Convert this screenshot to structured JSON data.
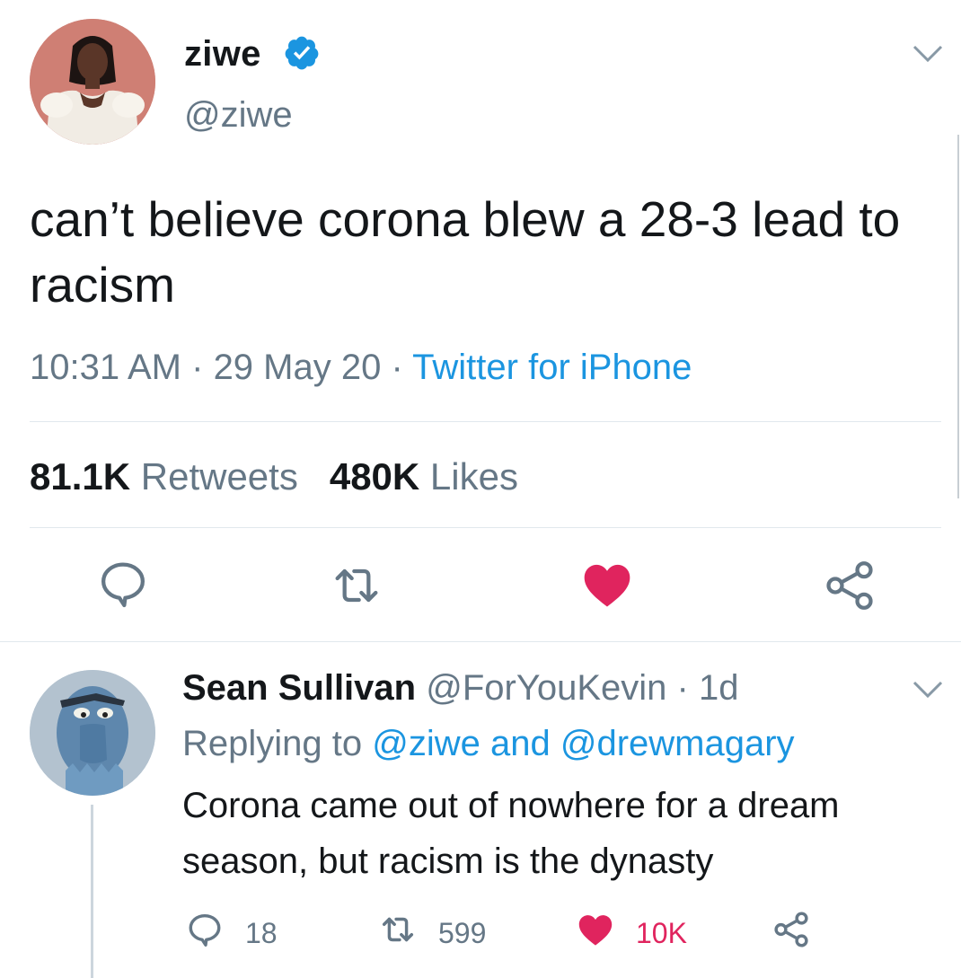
{
  "tweet": {
    "display_name": "ziwe",
    "handle": "@ziwe",
    "text": "can’t believe corona blew a 28-3 lead to racism",
    "time": "10:31 AM",
    "date": "29 May 20",
    "separator": " · ",
    "source": "Twitter for iPhone",
    "retweets_count": "81.1K",
    "retweets_label": "Retweets",
    "likes_count": "480K",
    "likes_label": "Likes",
    "liked": true
  },
  "reply": {
    "display_name": "Sean Sullivan",
    "handle": "@ForYouKevin",
    "age": "1d",
    "replying_prefix": "Replying to",
    "replying_user1": "@ziwe",
    "replying_and": "and",
    "replying_user2": "@drewmagary",
    "text": "Corona came out of nowhere for a dream season, but racism is the dynasty",
    "reply_count": "18",
    "retweet_count": "599",
    "like_count": "10K",
    "liked": true
  },
  "colors": {
    "accent": "#1b95e0",
    "like": "#e0245e",
    "secondary_text": "#657786",
    "divider": "#e1e8ed"
  },
  "icons": [
    "verified-badge-icon",
    "chevron-down-icon",
    "reply-icon",
    "retweet-icon",
    "heart-icon",
    "share-icon"
  ]
}
